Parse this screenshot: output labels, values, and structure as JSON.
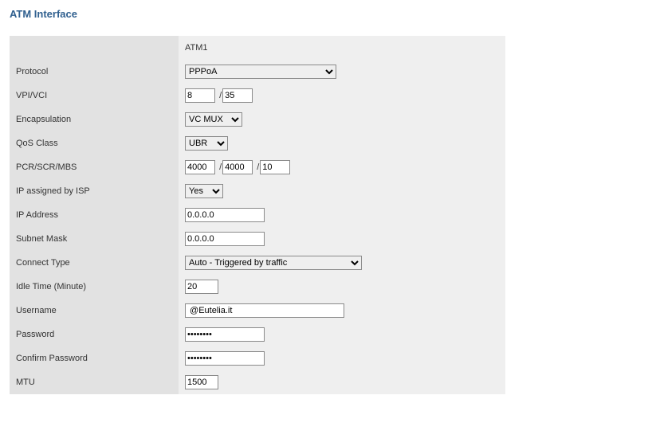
{
  "title": "ATM Interface",
  "column_header": "ATM1",
  "labels": {
    "protocol": "Protocol",
    "vpivci": "VPI/VCI",
    "encapsulation": "Encapsulation",
    "qos": "QoS Class",
    "pcrscrmbs": "PCR/SCR/MBS",
    "ipassigned": "IP assigned by ISP",
    "ipaddress": "IP Address",
    "subnet": "Subnet Mask",
    "connecttype": "Connect Type",
    "idletime": "Idle Time (Minute)",
    "username": "Username",
    "password": "Password",
    "confirm": "Confirm Password",
    "mtu": "MTU"
  },
  "values": {
    "protocol": "PPPoA",
    "vpi": "8",
    "vci": "35",
    "encapsulation": "VC MUX",
    "qos": "UBR",
    "pcr": "4000",
    "scr": "4000",
    "mbs": "10",
    "ipassigned": "Yes",
    "ipaddress": "0.0.0.0",
    "subnet": "0.0.0.0",
    "connecttype": "Auto - Triggered by traffic",
    "idletime": "20",
    "username": " @Eutelia.it",
    "password": "********",
    "confirm": "********",
    "mtu": "1500"
  }
}
